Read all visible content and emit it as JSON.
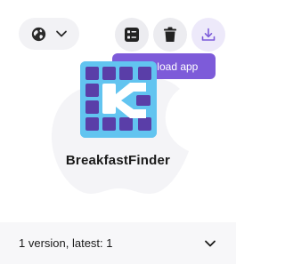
{
  "toolbar": {
    "language_icon": "globe-icon",
    "language_dropdown_icon": "chevron-down-icon",
    "details_icon": "list-details-icon",
    "delete_icon": "trash-icon",
    "download_icon": "download-icon"
  },
  "tooltip": {
    "label": "Download app"
  },
  "app": {
    "name": "BreakfastFinder",
    "icon": "breakfastfinder-app-icon"
  },
  "versions": {
    "summary": "1 version, latest: 1",
    "expand_icon": "chevron-down-icon"
  },
  "colors": {
    "accent": "#7d5bd9",
    "icon_background": "#62c4f0",
    "icon_squares": "#5a3ea8",
    "dark_icon": "#222222"
  }
}
